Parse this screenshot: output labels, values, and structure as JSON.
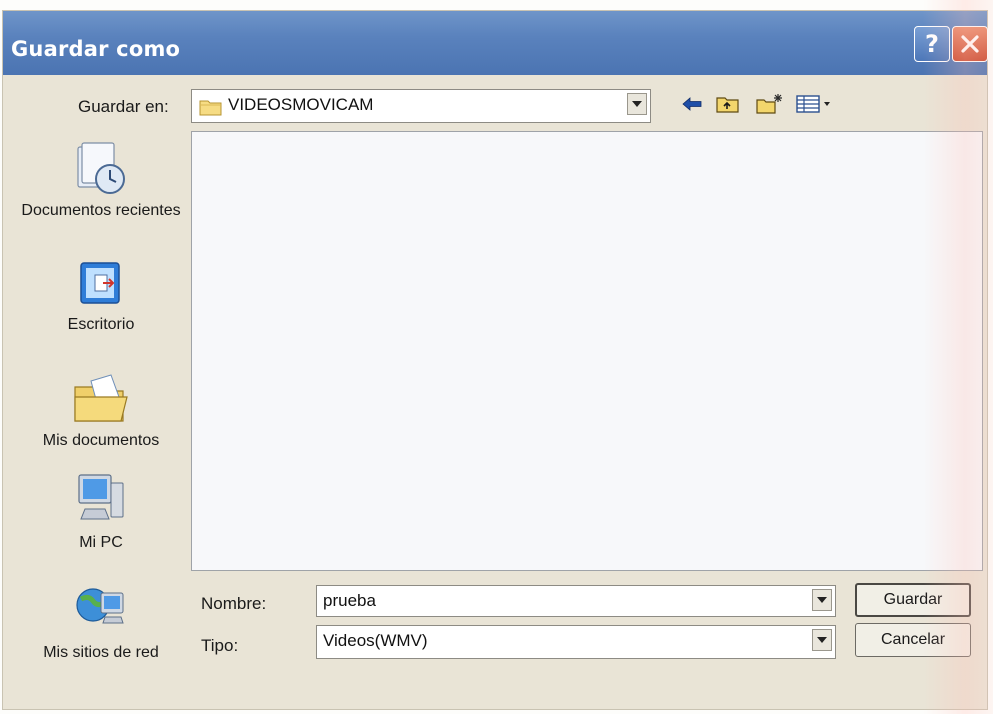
{
  "window": {
    "title": "Guardar como"
  },
  "titlebar": {
    "help_icon": "help-icon",
    "close_icon": "close-icon",
    "help_label": "?"
  },
  "save_in": {
    "label": "Guardar en:",
    "value": "VIDEOSMOVICAM",
    "icon": "folder-icon"
  },
  "toolbar": {
    "back_icon": "back-arrow-icon",
    "up_icon": "up-one-level-icon",
    "new_folder_icon": "new-folder-icon",
    "view_menu_icon": "view-menu-icon"
  },
  "places": [
    {
      "label": "Documentos recientes",
      "icon": "recent-documents-icon"
    },
    {
      "label": "Escritorio",
      "icon": "desktop-icon"
    },
    {
      "label": "Mis documentos",
      "icon": "my-documents-icon"
    },
    {
      "label": "Mi PC",
      "icon": "my-computer-icon"
    },
    {
      "label": "Mis sitios de red",
      "icon": "network-places-icon"
    }
  ],
  "filename": {
    "label": "Nombre:",
    "value": "prueba"
  },
  "filetype": {
    "label": "Tipo:",
    "value": "Videos(WMV)"
  },
  "buttons": {
    "save_label": "Guardar",
    "cancel_label": "Cancelar"
  },
  "colors": {
    "titlebar": "#5a82bd",
    "dialog_background": "#e9e4d6",
    "close_button": "#c9472c"
  }
}
